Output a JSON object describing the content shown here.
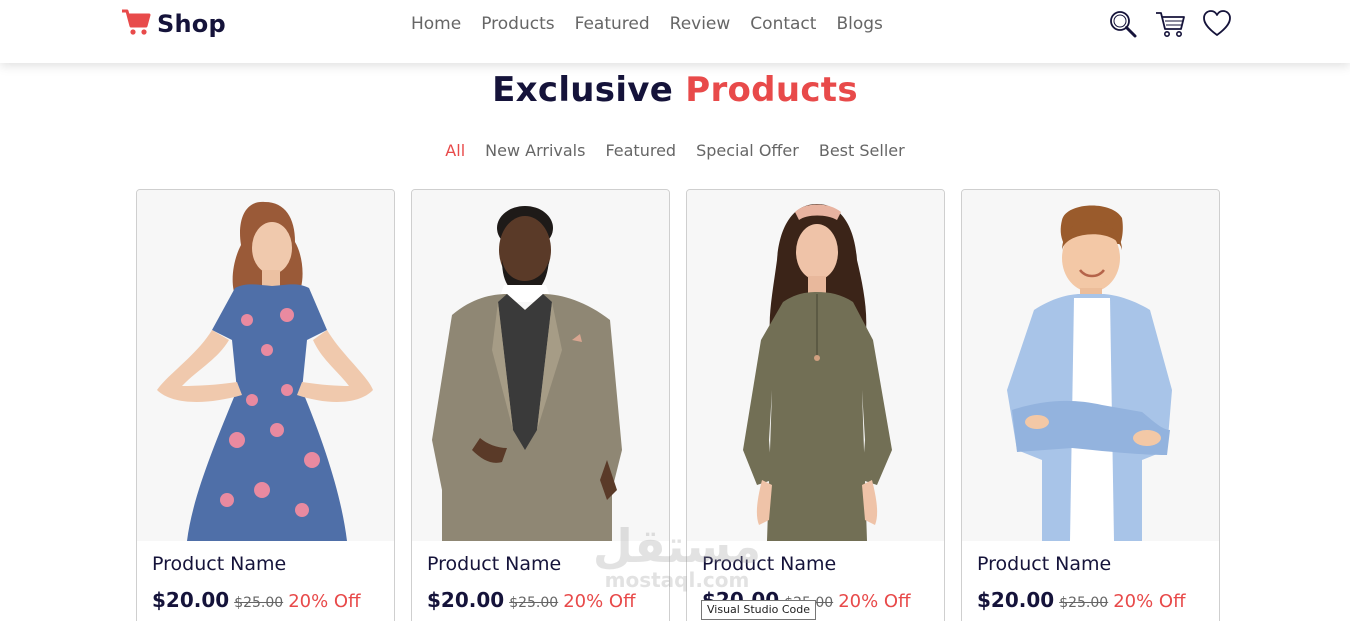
{
  "brand": {
    "name": "Shop",
    "icon": "cart-icon",
    "color": "#e84a4a"
  },
  "nav": {
    "links": [
      "Home",
      "Products",
      "Featured",
      "Review",
      "Contact",
      "Blogs"
    ],
    "icons": [
      "search-icon",
      "cart-icon",
      "heart-icon"
    ]
  },
  "section": {
    "title_main": "Exclusive",
    "title_accent": "Products"
  },
  "filters": {
    "items": [
      "All",
      "New Arrivals",
      "Featured",
      "Special Offer",
      "Best Seller"
    ],
    "active": "All"
  },
  "products": [
    {
      "name": "Product Name",
      "price": "$20.00",
      "old_price": "$25.00",
      "discount": "20% Off",
      "image": "woman-floral-dress-photo"
    },
    {
      "name": "Product Name",
      "price": "$20.00",
      "old_price": "$25.00",
      "discount": "20% Off",
      "image": "man-tweed-blazer-photo"
    },
    {
      "name": "Product Name",
      "price": "$20.00",
      "old_price": "$25.00",
      "discount": "20% Off",
      "image": "woman-olive-dress-photo"
    },
    {
      "name": "Product Name",
      "price": "$20.00",
      "old_price": "$25.00",
      "discount": "20% Off",
      "image": "boy-blue-shirt-photo"
    }
  ],
  "watermark": {
    "arabic": "مستقل",
    "latin": "mostaql.com"
  },
  "tooltip": {
    "text": "Visual Studio Code"
  },
  "colors": {
    "accent": "#e84a4a",
    "dark": "#15133a",
    "muted": "#666666"
  }
}
